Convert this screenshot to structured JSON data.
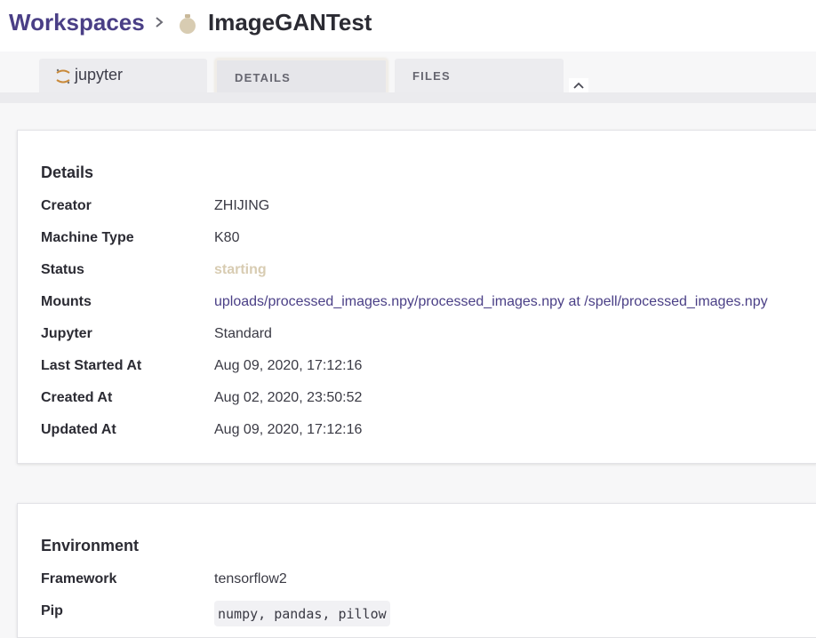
{
  "breadcrumb": {
    "root": "Workspaces",
    "current": "ImageGANTest"
  },
  "tabs": {
    "jupyter": "jupyter",
    "details": "DETAILS",
    "files": "FILES"
  },
  "details": {
    "title": "Details",
    "rows": [
      {
        "label": "Creator",
        "value": "ZHIJING"
      },
      {
        "label": "Machine Type",
        "value": "K80"
      },
      {
        "label": "Status",
        "value": "starting"
      },
      {
        "label": "Mounts",
        "value": "uploads/processed_images.npy/processed_images.npy at /spell/processed_images.npy"
      },
      {
        "label": "Jupyter",
        "value": "Standard"
      },
      {
        "label": "Last Started At",
        "value": "Aug 09, 2020, 17:12:16"
      },
      {
        "label": "Created At",
        "value": "Aug 02, 2020, 23:50:52"
      },
      {
        "label": "Updated At",
        "value": "Aug 09, 2020, 17:12:16"
      }
    ]
  },
  "environment": {
    "title": "Environment",
    "rows": [
      {
        "label": "Framework",
        "value": "tensorflow2"
      },
      {
        "label": "Pip",
        "value": "numpy, pandas, pillow"
      }
    ]
  },
  "colors": {
    "brand": "#4a3f86",
    "status_starting": "#d8ccb2"
  },
  "icons": {
    "separator": "chevron-right-icon",
    "workspace": "workspace-status-icon",
    "jupyter": "jupyter-logo-icon",
    "collapse": "chevron-up-icon"
  }
}
